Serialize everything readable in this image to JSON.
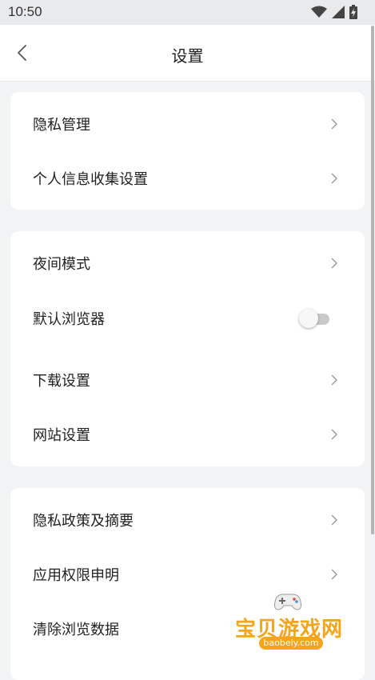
{
  "status_bar": {
    "time": "10:50"
  },
  "header": {
    "title": "设置"
  },
  "sections": [
    {
      "items": [
        {
          "label": "隐私管理",
          "control": "chevron"
        },
        {
          "label": "个人信息收集设置",
          "control": "chevron"
        }
      ]
    },
    {
      "items": [
        {
          "label": "夜间模式",
          "control": "chevron"
        },
        {
          "label": "默认浏览器",
          "control": "toggle",
          "toggle_on": false
        },
        {
          "label": "下载设置",
          "control": "chevron"
        },
        {
          "label": "网站设置",
          "control": "chevron"
        }
      ]
    },
    {
      "items": [
        {
          "label": "隐私政策及摘要",
          "control": "chevron"
        },
        {
          "label": "应用权限申明",
          "control": "chevron"
        },
        {
          "label": "清除浏览数据",
          "control": "chevron"
        }
      ]
    }
  ],
  "watermark": {
    "brand": "宝贝游戏网",
    "url": "baobeiy.com"
  },
  "colors": {
    "background": "#f2f3f5",
    "card": "#ffffff",
    "chevron": "#999999",
    "watermark": "#f5a51c"
  }
}
